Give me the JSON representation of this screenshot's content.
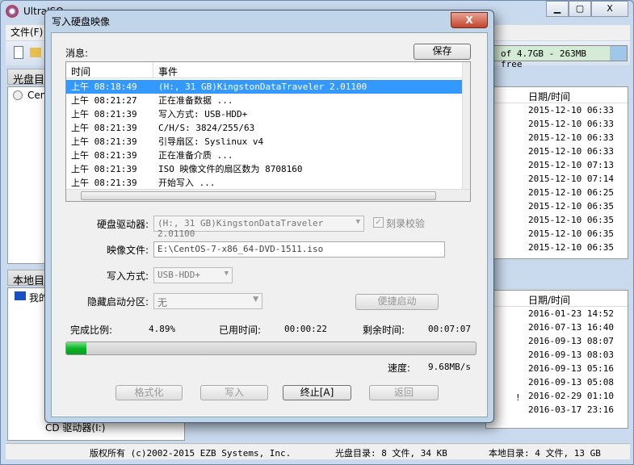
{
  "main": {
    "title": "UltraISO",
    "menu_file": "文件(F)",
    "capacity": "of 4.7GB - 263MB free",
    "iso_panel": "光盘目录",
    "local_panel": "本地目录",
    "iso_tree_root": "CentOS",
    "local_tree_root": "我的电脑",
    "local_tree_cd": "CD 驱动器(I:)",
    "date_col": "日期/时间",
    "iso_dates": [
      "2015-12-10 06:33",
      "2015-12-10 06:33",
      "2015-12-10 06:33",
      "2015-12-10 06:33",
      "2015-12-10 07:13",
      "2015-12-10 07:14",
      "2015-12-10 06:25",
      "2015-12-10 06:35",
      "2015-12-10 06:35",
      "2015-12-10 06:35",
      "2015-12-10 06:35"
    ],
    "local_dates": [
      "2016-01-23 14:52",
      "2016-07-13 16:40",
      "2016-09-13 08:07",
      "2016-09-13 08:03",
      "2016-09-13 05:16",
      "2016-09-13 05:08",
      "2016-02-29 01:10",
      "2016-03-17 23:16"
    ],
    "local_flag": "!",
    "status": {
      "copyright": "版权所有 (c)2002-2015 EZB Systems, Inc.",
      "iso_dir": "光盘目录: 8 文件, 34 KB",
      "local_dir": "本地目录: 4 文件, 13 GB"
    }
  },
  "dialog": {
    "title": "写入硬盘映像",
    "close": "X",
    "messages_label": "消息:",
    "save": "保存",
    "columns": {
      "time": "时间",
      "event": "事件"
    },
    "messages": [
      {
        "time": "上午 08:18:49",
        "event": "(H:, 31 GB)KingstonDataTraveler 2.01100"
      },
      {
        "time": "上午 08:21:27",
        "event": "正在准备数据 ..."
      },
      {
        "time": "上午 08:21:39",
        "event": "写入方式: USB-HDD+"
      },
      {
        "time": "上午 08:21:39",
        "event": "C/H/S: 3824/255/63"
      },
      {
        "time": "上午 08:21:39",
        "event": "引导扇区: Syslinux v4"
      },
      {
        "time": "上午 08:21:39",
        "event": "正在准备介质 ..."
      },
      {
        "time": "上午 08:21:39",
        "event": "ISO 映像文件的扇区数为 8708160"
      },
      {
        "time": "上午 08:21:39",
        "event": "开始写入 ..."
      }
    ],
    "drive_label": "硬盘驱动器:",
    "drive_value": "(H:, 31 GB)KingstonDataTraveler 2.01100",
    "verify_label": "刻录校验",
    "verify_checked": true,
    "image_label": "映像文件:",
    "image_value": "E:\\CentOS-7-x86_64-DVD-1511.iso",
    "method_label": "写入方式:",
    "method_value": "USB-HDD+",
    "hidden_label": "隐藏启动分区:",
    "hidden_value": "无",
    "quickboot": "便捷启动",
    "progress_label": "完成比例:",
    "progress_value": "4.89%",
    "progress_percent": 4.89,
    "elapsed_label": "已用时间:",
    "elapsed_value": "00:00:22",
    "remaining_label": "剩余时间:",
    "remaining_value": "00:07:07",
    "speed_label": "速度:",
    "speed_value": "9.68MB/s",
    "buttons": {
      "format": "格式化",
      "write": "写入",
      "abort": "终止[A]",
      "back": "返回"
    }
  }
}
